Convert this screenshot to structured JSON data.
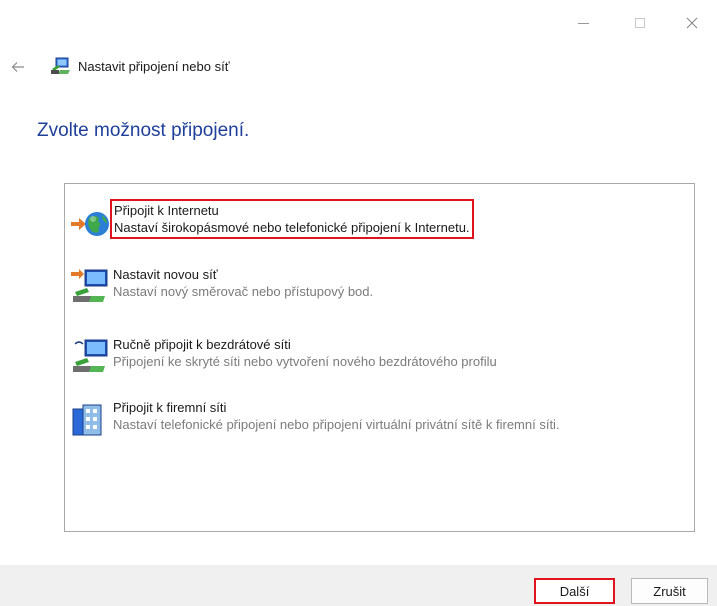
{
  "window": {
    "controls": {
      "minimize_icon": "minimize-icon",
      "maximize_icon": "maximize-icon",
      "close_icon": "close-icon"
    }
  },
  "header": {
    "back_icon": "back-arrow-icon",
    "icon": "network-setup-icon",
    "title": "Nastavit připojení nebo síť"
  },
  "main": {
    "heading": "Zvolte možnost připojení.",
    "options": [
      {
        "icon": "globe-internet-icon",
        "title": "Připojit k Internetu",
        "description": "Nastaví širokopásmové nebo telefonické připojení k Internetu.",
        "selected": true
      },
      {
        "icon": "new-network-icon",
        "title": "Nastavit novou síť",
        "description": "Nastaví nový směrovač nebo přístupový bod.",
        "selected": false
      },
      {
        "icon": "wireless-network-icon",
        "title": "Ručně připojit k bezdrátové síti",
        "description": "Připojení ke skryté síti nebo vytvoření nového bezdrátového profilu",
        "selected": false
      },
      {
        "icon": "workplace-network-icon",
        "title": "Připojit k firemní síti",
        "description": "Nastaví telefonické připojení nebo připojení virtuální privátní sítě k firemní síti.",
        "selected": false
      }
    ]
  },
  "footer": {
    "next_label": "Další",
    "cancel_label": "Zrušit"
  },
  "colors": {
    "heading": "#1f3f9a",
    "highlight": "#e0141e",
    "footer_bg": "#f0f0f0"
  }
}
